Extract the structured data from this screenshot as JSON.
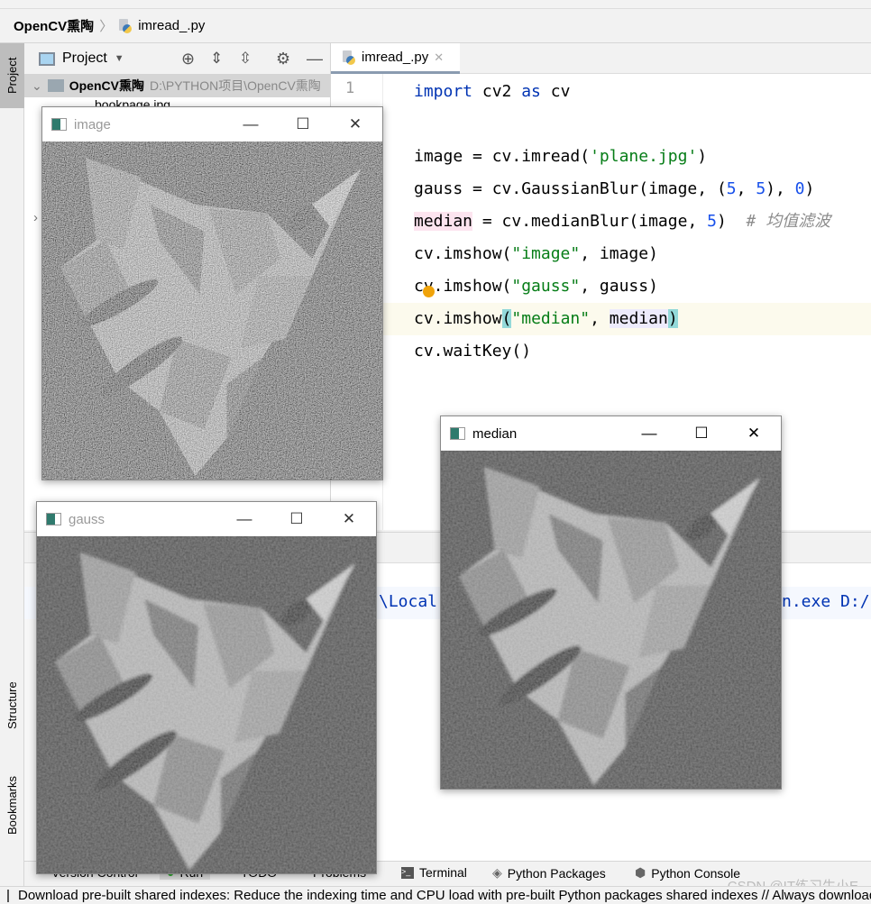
{
  "breadcrumb": {
    "project": "OpenCV熏陶",
    "file": "imread_.py"
  },
  "sidebar": {
    "project_tab": "Project",
    "structure_tab": "Structure",
    "bookmarks_tab": "Bookmarks"
  },
  "project_panel": {
    "title": "Project",
    "root_name": "OpenCV熏陶",
    "root_path": "D:\\PYTHON项目\\OpenCV熏陶",
    "child": "bookpage.jpg"
  },
  "editor": {
    "tab": "imread_.py",
    "line_number": "1",
    "lines": [
      {
        "a": "import",
        "b": " cv2 ",
        "c": "as",
        "d": " cv"
      },
      {
        "a": "image = cv.imread(",
        "s": "'plane.jpg'",
        "e": ")"
      },
      {
        "a": "gauss = cv.GaussianBlur(image, (",
        "n1": "5",
        ",": ", ",
        "n2": "5",
        "m": "), ",
        "n3": "0",
        "e": ")"
      },
      {
        "v": "median",
        "a": " = cv.medianBlur(image, ",
        "n": "5",
        "e": ")",
        "c": "  # 均值滤波"
      },
      {
        "a": "cv.imshow(",
        "s": "\"image\"",
        "e": ", image)"
      },
      {
        "a": "cv.imshow(",
        "s": "\"gauss\"",
        "e": ", gauss)"
      },
      {
        "a": "cv.imshow",
        "p1": "(",
        "s": "\"median\"",
        "m": ", ",
        "v": "median",
        "p2": ")"
      },
      {
        "a": "cv.waitKey()"
      }
    ]
  },
  "run_panel": {
    "output_left": "\\Local",
    "output_right": "n.exe D:/"
  },
  "tool_windows": [
    "Version Control",
    "Run",
    "TODO",
    "Problems",
    "Terminal",
    "Python Packages",
    "Python Console"
  ],
  "status": "Download pre-built shared indexes: Reduce the indexing time and CPU load with pre-built Python packages shared indexes // Always download // Download once",
  "watermark": "CSDN @IT练习生小E",
  "windows": {
    "image": "image",
    "gauss": "gauss",
    "median": "median"
  },
  "icons": {
    "minimize": "—",
    "maximize": "☐",
    "close": "✕"
  }
}
